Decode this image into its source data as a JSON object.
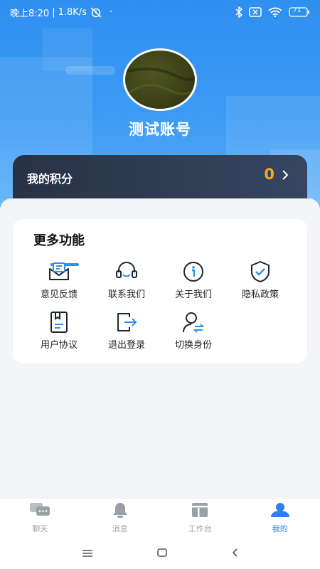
{
  "status_bar": {
    "time": "晚上8:20",
    "speed": "1.8K/s",
    "dot": "·",
    "battery": "71",
    "icons": [
      "alarm-off-icon",
      "bluetooth-icon",
      "sim-off-icon",
      "wifi-icon",
      "battery-icon"
    ]
  },
  "profile": {
    "username": "测试账号"
  },
  "points": {
    "label": "我的积分",
    "value": "0",
    "value_color": "#f5a623"
  },
  "functions": {
    "title": "更多功能",
    "items": [
      {
        "label": "意见反馈",
        "icon": "feedback-icon"
      },
      {
        "label": "联系我们",
        "icon": "headset-icon"
      },
      {
        "label": "关于我们",
        "icon": "info-icon"
      },
      {
        "label": "隐私政策",
        "icon": "shield-icon"
      },
      {
        "label": "用户协议",
        "icon": "document-icon"
      },
      {
        "label": "退出登录",
        "icon": "logout-icon"
      },
      {
        "label": "切换身份",
        "icon": "switch-user-icon"
      }
    ]
  },
  "tabs": [
    {
      "label": "聊天",
      "icon": "chat-icon",
      "active": false
    },
    {
      "label": "消息",
      "icon": "bell-icon",
      "active": false
    },
    {
      "label": "工作台",
      "icon": "workbench-icon",
      "active": false
    },
    {
      "label": "我的",
      "icon": "user-icon",
      "active": true
    }
  ],
  "theme": {
    "primary": "#2f8ff0",
    "accent": "#f5a623",
    "tab_active": "#2f7ff0",
    "tab_inactive": "#9aa0a8"
  },
  "nav": [
    "menu-icon",
    "home-icon",
    "back-icon"
  ]
}
